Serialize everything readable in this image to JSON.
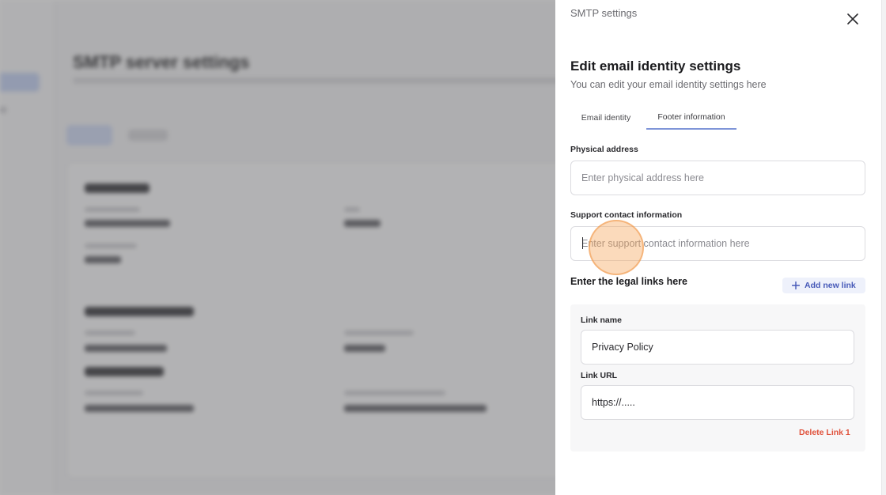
{
  "drawer": {
    "header_title": "SMTP settings",
    "title": "Edit email identity settings",
    "subtitle": "You can edit your email identity settings here",
    "tabs": [
      {
        "label": "Email identity",
        "active": false
      },
      {
        "label": "Footer information",
        "active": true
      }
    ],
    "physical_address": {
      "label": "Physical address",
      "placeholder": "Enter physical address here",
      "value": ""
    },
    "support_contact": {
      "label": "Support contact information",
      "placeholder": "Enter support contact information here",
      "value": ""
    },
    "legal_links": {
      "label": "Enter the legal links here",
      "add_button": "Add new link",
      "links": [
        {
          "name_label": "Link name",
          "name_value": "Privacy Policy",
          "url_label": "Link URL",
          "url_value": "https://.....",
          "delete_label": "Delete Link 1"
        }
      ]
    }
  },
  "background": {
    "page_title": "SMTP server settings"
  },
  "colors": {
    "accent": "#4659b8",
    "tab_underline": "#7f95d8",
    "danger": "#e0533d",
    "overlay": "#3c3c40"
  },
  "icons": {
    "close": "close-icon",
    "add": "plus-icon"
  }
}
